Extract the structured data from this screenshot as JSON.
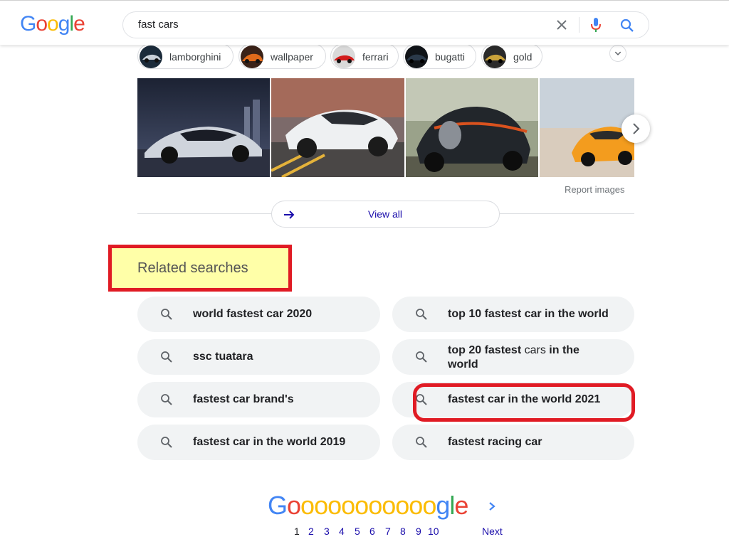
{
  "search": {
    "query": "fast cars"
  },
  "logo": {
    "letters": [
      "G",
      "o",
      "o",
      "g",
      "l",
      "e"
    ],
    "colors": [
      "#4285f4",
      "#ea4335",
      "#fbbc05",
      "#4285f4",
      "#34a853",
      "#ea4335"
    ]
  },
  "chips": [
    {
      "label": "lamborghini",
      "icon": "lamborghini-thumbnail"
    },
    {
      "label": "wallpaper",
      "icon": "wallpaper-thumbnail"
    },
    {
      "label": "ferrari",
      "icon": "ferrari-thumbnail"
    },
    {
      "label": "bugatti",
      "icon": "bugatti-thumbnail"
    },
    {
      "label": "gold",
      "icon": "gold-car-thumbnail"
    }
  ],
  "images": {
    "report_label": "Report images",
    "view_all_label": "View all"
  },
  "related": {
    "title": "Related searches",
    "items": [
      {
        "bold": "world fastest car 2020"
      },
      {
        "bold": "top 10 fastest car in the world"
      },
      {
        "bold": "ssc tuatara"
      },
      {
        "part1": "top 20 fastest",
        "part2": "cars",
        "part3": "in the",
        "line2": "world"
      },
      {
        "bold": "fastest car brand's"
      },
      {
        "bold": "fastest car in the world 2021"
      },
      {
        "bold": "fastest car in the world 2019"
      },
      {
        "bold": "fastest racing car"
      }
    ]
  },
  "pagination": {
    "logo_text": "Gooooooooooogle",
    "pages": [
      "1",
      "2",
      "3",
      "4",
      "5",
      "6",
      "7",
      "8",
      "9",
      "10"
    ],
    "current_page": "1",
    "next_label": "Next"
  },
  "colors": {
    "link": "#1a0dab",
    "highlight_border": "#e01b24",
    "highlight_fill": "#ffffa8",
    "chip_bg": "#f1f3f4"
  }
}
